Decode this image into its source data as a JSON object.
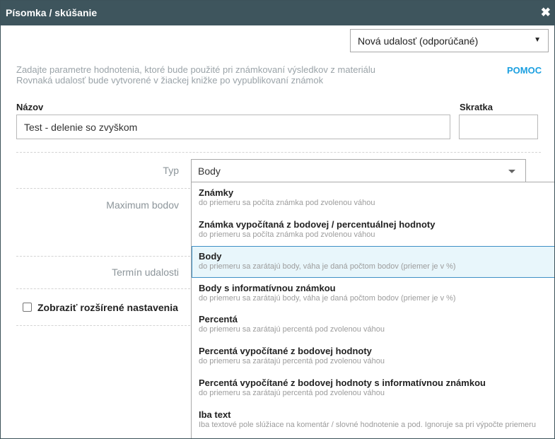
{
  "window": {
    "title": "Písomka / skúšanie",
    "close_label": "✖"
  },
  "event_select": {
    "value": "Nová udalosť (odporúčané)",
    "caret": "▼"
  },
  "help": {
    "line1": "Zadajte parametre hodnotenia, ktoré bude použité pri známkovaní výsledkov z materiálu",
    "line2": "Rovnaká udalosť bude vytvorené v žiackej knižke po vypublikovaní známok",
    "link": "POMOC"
  },
  "form": {
    "name_label": "Názov",
    "name_value": "Test - delenie so zvyškom",
    "abbr_label": "Skratka",
    "abbr_value": "",
    "type_label": "Typ",
    "type_value": "Body",
    "max_label": "Maximum bodov",
    "term_label": "Termín udalosti",
    "advanced_label": "Zobraziť rozšírené nastavenia"
  },
  "type_options": [
    {
      "title": "Známky",
      "desc": "do priemeru sa počíta známka pod zvolenou váhou"
    },
    {
      "title": "Známka vypočítaná z bodovej / percentuálnej hodnoty",
      "desc": "do priemeru sa počíta známka pod zvolenou váhou"
    },
    {
      "title": "Body",
      "desc": "do priemeru sa zarátajú body, váha je daná počtom bodov (priemer je v %)"
    },
    {
      "title": "Body s informatívnou známkou",
      "desc": "do priemeru sa zarátajú body, váha je daná počtom bodov (priemer je v %)"
    },
    {
      "title": "Percentá",
      "desc": "do priemeru sa zarátajú percentá pod zvolenou váhou"
    },
    {
      "title": "Percentá vypočítané z bodovej hodnoty",
      "desc": "do priemeru sa zarátajú percentá pod zvolenou váhou"
    },
    {
      "title": "Percentá vypočítané z bodovej hodnoty s informatívnou známkou",
      "desc": "do priemeru sa zarátajú percentá pod zvolenou váhou"
    },
    {
      "title": "Iba text",
      "desc": "Iba textové pole slúžiace na komentár / slovné hodnotenie a pod. Ignoruje sa pri výpočte priemeru"
    }
  ],
  "colors": {
    "titlebar": "#3e555d",
    "link": "#1a9fe0",
    "selected_bg": "#e8f6fb",
    "selected_border": "#3e90c5"
  }
}
